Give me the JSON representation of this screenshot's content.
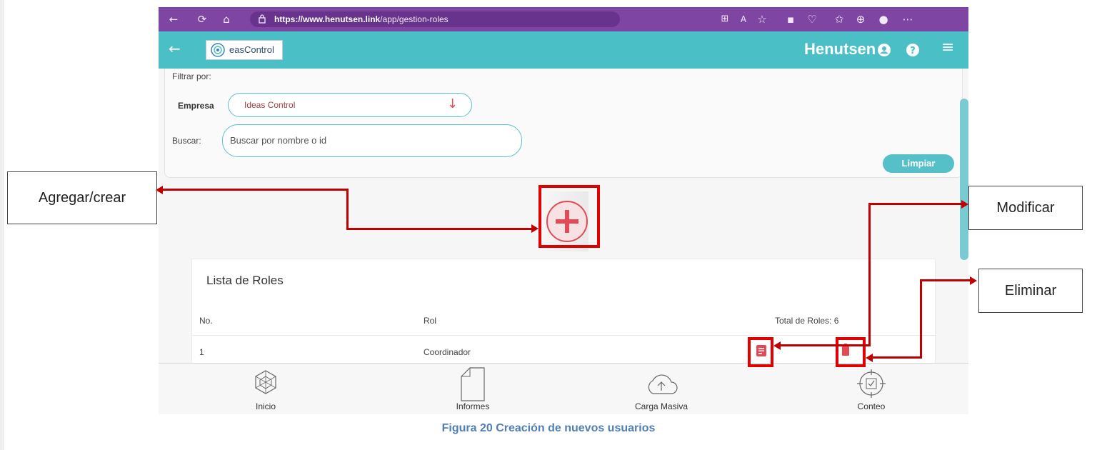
{
  "browser": {
    "url_domain": "https://www.henutsen.link",
    "url_path": "/app/gestion-roles",
    "toolbar_icons": [
      "back-icon",
      "refresh-icon",
      "home-icon",
      "lock-icon",
      "reader-view-icon",
      "read-aloud-icon",
      "favorite-icon",
      "extensions-icon",
      "browser-essentials-icon",
      "favorites-icon",
      "collections-icon",
      "profile-icon",
      "more-icon"
    ]
  },
  "app": {
    "logo_text": "easControl",
    "brand": "Henutsen",
    "colors": {
      "appbar": "#4abfc6",
      "browser_frame": "#7e46a2",
      "accent_red": "#e34a56",
      "annotation_red": "#c00000"
    }
  },
  "filters": {
    "title": "Filtrar por:",
    "empresa_label": "Empresa",
    "empresa_value": "Ideas Control",
    "buscar_label": "Buscar:",
    "buscar_placeholder": "Buscar por nombre o id",
    "clear_button": "Limpiar"
  },
  "list": {
    "title": "Lista de Roles",
    "headers": {
      "no": "No.",
      "rol": "Rol",
      "total": "Total de Roles: 6"
    },
    "rows": [
      {
        "no": "1",
        "rol": "Coordinador"
      }
    ]
  },
  "bottom_nav": {
    "items": [
      {
        "label": "Inicio",
        "icon": "home-cube-icon"
      },
      {
        "label": "Informes",
        "icon": "document-icon"
      },
      {
        "label": "Carga Masiva",
        "icon": "cloud-upload-icon"
      },
      {
        "label": "Conteo",
        "icon": "count-target-icon"
      }
    ]
  },
  "annotations": {
    "add": "Agregar/crear",
    "edit": "Modificar",
    "delete": "Eliminar"
  },
  "caption": "Figura 20 Creación de nuevos usuarios"
}
